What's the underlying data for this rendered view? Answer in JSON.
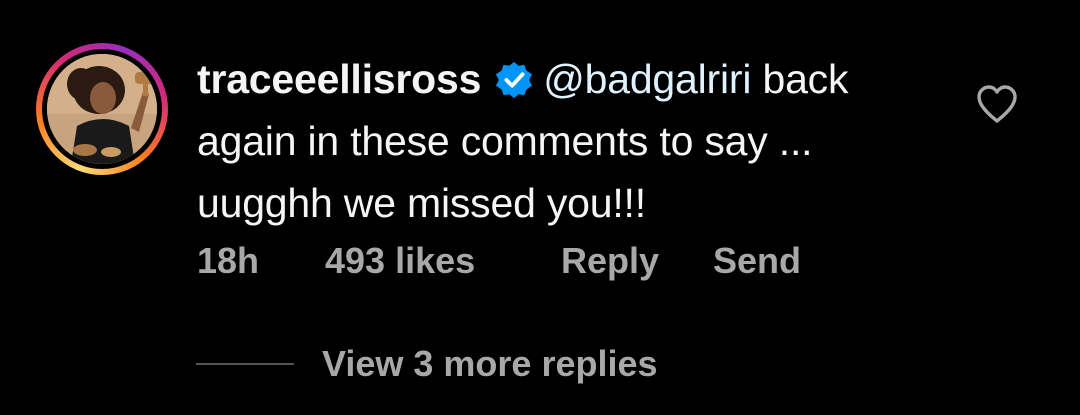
{
  "comment": {
    "username": "traceeellisross",
    "verified": true,
    "verified_icon": "verified-badge-icon",
    "mention": "@badgalriri",
    "text": " back again in these comments to say ... uugghh we missed you!!!",
    "time": "18h",
    "likes": "493 likes",
    "reply_label": "Reply",
    "send_label": "Send",
    "like_icon": "heart-icon"
  },
  "replies": {
    "view_more_label": "View 3 more replies"
  },
  "colors": {
    "background": "#000000",
    "text": "#f5f5f5",
    "muted": "#a8a8a8",
    "verified_blue": "#0095f6",
    "mention": "#e0f1ff"
  }
}
